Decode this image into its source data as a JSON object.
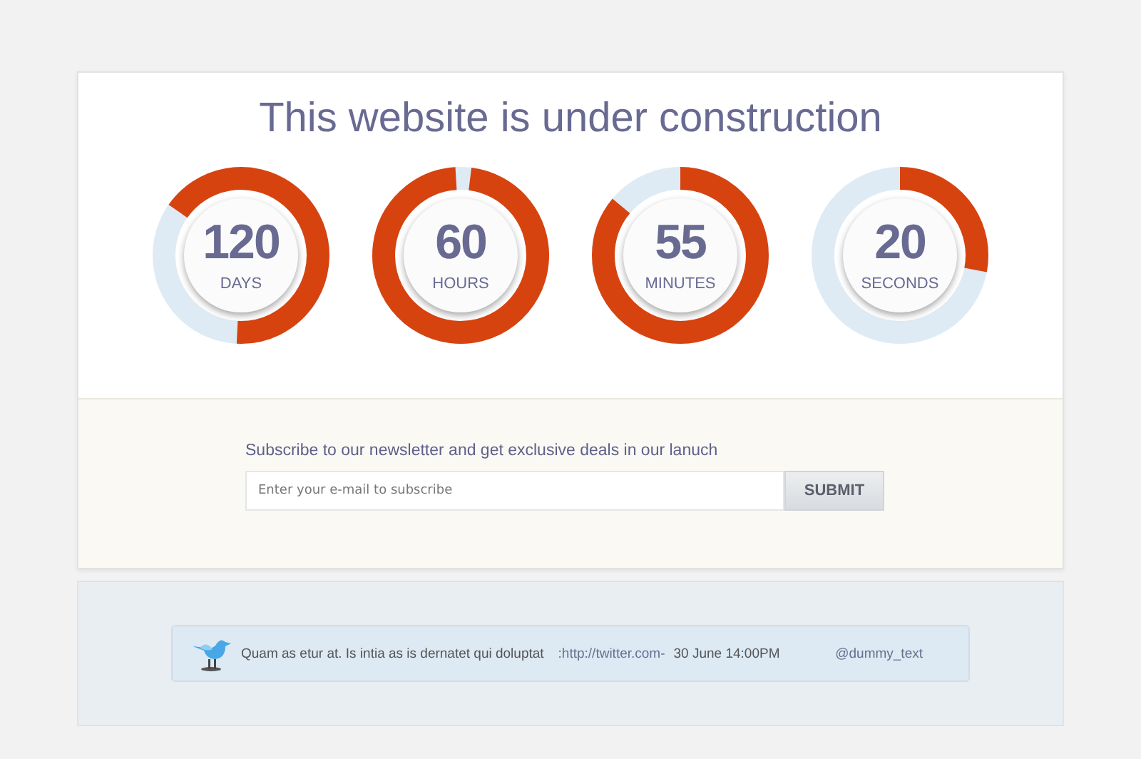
{
  "title": "This website is under construction",
  "dials": [
    {
      "value": "120",
      "unit": "DAYS"
    },
    {
      "value": "60",
      "unit": "HOURS"
    },
    {
      "value": "55",
      "unit": "MINUTES"
    },
    {
      "value": "20",
      "unit": "SECONDS"
    }
  ],
  "newsletter": {
    "prompt": "Subscribe to our newsletter and get exclusive deals in our lanuch",
    "placeholder": "Enter your e-mail to subscribe",
    "button": "SUBMIT"
  },
  "tweet": {
    "text": "Quam as etur at. Is intia as is dernatet qui doluptat",
    "link": ":http://twitter.com-",
    "date": "30 June 14:00PM",
    "handle": "@dummy_text"
  }
}
